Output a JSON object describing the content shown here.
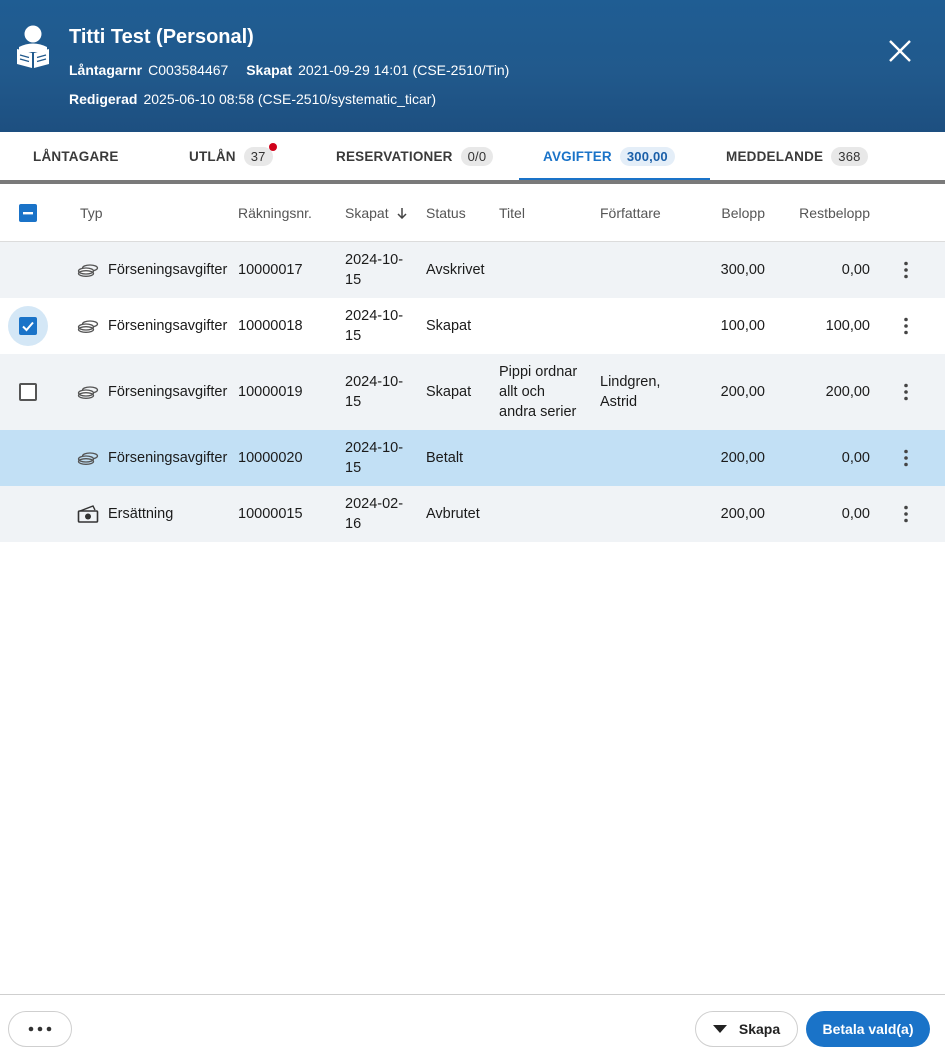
{
  "header": {
    "title": "Titti Test (Personal)",
    "borrower_number_label": "Låntagarnr",
    "borrower_number": "C003584467",
    "created_label": "Skapat",
    "created": "2021-09-29 14:01 (CSE-2510/Tin)",
    "edited_label": "Redigerad",
    "edited": "2025-06-10 08:58 (CSE-2510/systematic_ticar)",
    "avatar_icon": "reader-icon",
    "close_icon": "close-icon"
  },
  "tabs": [
    {
      "label": "LÅNTAGARE",
      "badge": ""
    },
    {
      "label": "UTLÅN",
      "badge": "37"
    },
    {
      "label": "RESERVATIONER",
      "badge": "0/0"
    },
    {
      "label": "AVGIFTER",
      "badge": "300,00"
    },
    {
      "label": "MEDDELANDE",
      "badge": "368"
    }
  ],
  "active_tab": "AVGIFTER",
  "columns": {
    "typ": "Typ",
    "rakningsnr": "Räkningsnr.",
    "skapat": "Skapat",
    "status": "Status",
    "titel": "Titel",
    "forfattare": "Författare",
    "belopp": "Belopp",
    "restbelopp": "Restbelopp"
  },
  "rows": [
    {
      "type": "Förseningsavgifter",
      "icon": "coins-icon",
      "nr": "10000017",
      "created_1": "2024-10-",
      "created_2": "15",
      "status": "Avskrivet",
      "title": "",
      "author": "",
      "amount": "300,00",
      "rest": "0,00",
      "checkbox": "none"
    },
    {
      "type": "Förseningsavgifter",
      "icon": "coins-icon",
      "nr": "10000018",
      "created_1": "2024-10-",
      "created_2": "15",
      "status": "Skapat",
      "title": "",
      "author": "",
      "amount": "100,00",
      "rest": "100,00",
      "checkbox": "checked"
    },
    {
      "type": "Förseningsavgifter",
      "icon": "coins-icon",
      "nr": "10000019",
      "created_1": "2024-10-",
      "created_2": "15",
      "status": "Skapat",
      "title_1": "Pippi ordnar",
      "title_2": "allt och",
      "title_3": "andra serier",
      "author_1": "Lindgren,",
      "author_2": "Astrid",
      "amount": "200,00",
      "rest": "200,00",
      "checkbox": "unchecked"
    },
    {
      "type": "Förseningsavgifter",
      "icon": "coins-icon",
      "nr": "10000020",
      "created_1": "2024-10-",
      "created_2": "15",
      "status": "Betalt",
      "title": "",
      "author": "",
      "amount": "200,00",
      "rest": "0,00",
      "checkbox": "none"
    },
    {
      "type": "Ersättning",
      "icon": "banknote-icon",
      "nr": "10000015",
      "created_1": "2024-02-",
      "created_2": "16",
      "status": "Avbrutet",
      "title": "",
      "author": "",
      "amount": "200,00",
      "rest": "0,00",
      "checkbox": "none"
    }
  ],
  "footer": {
    "more_label": "•••",
    "create_label": "Skapa",
    "pay_label": "Betala vald(a)"
  },
  "colors": {
    "header_bg": "#21598c",
    "accent": "#1a73c8",
    "selected_row": "#c2e0f5",
    "alt_row": "#f0f3f6"
  }
}
